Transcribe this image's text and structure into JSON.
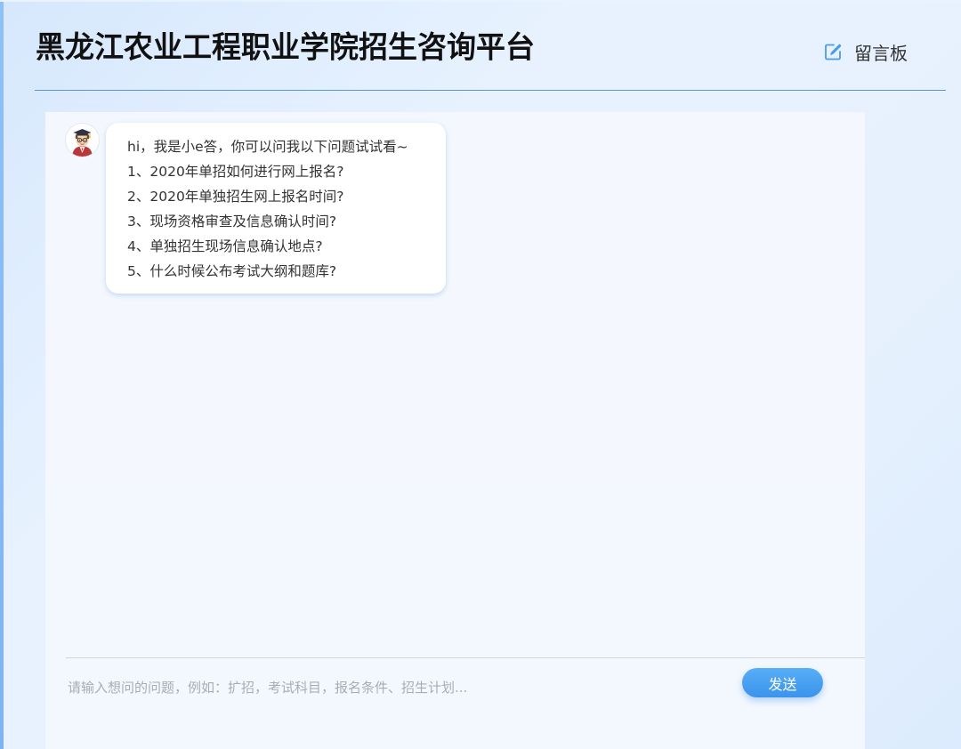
{
  "header": {
    "title": "黑龙江农业工程职业学院招生咨询平台",
    "message_board_label": "留言板",
    "message_board_icon": "edit-icon"
  },
  "chat": {
    "bot_avatar_icon": "professor-avatar-icon",
    "greeting": "hi，我是小e答，你可以问我以下问题试试看~",
    "suggested_questions": [
      "1、2020年单招如何进行网上报名?",
      "2、2020年单独招生网上报名时间?",
      "3、现场资格审查及信息确认时间?",
      "4、单独招生现场信息确认地点?",
      "5、什么时候公布考试大纲和题库?"
    ]
  },
  "input": {
    "placeholder": "请输入想问的问题，例如：扩招，考试科目，报名条件、招生计划...",
    "value": "",
    "send_label": "发送"
  },
  "colors": {
    "accent": "#3b93ec",
    "header_rule": "#5f97c4",
    "background": "#e8f2fe"
  }
}
